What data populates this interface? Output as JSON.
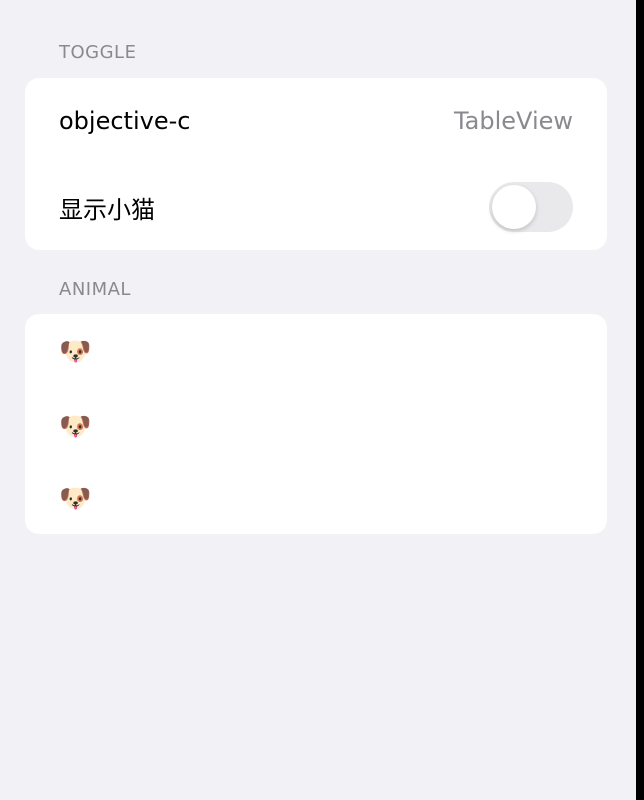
{
  "sections": {
    "toggle": {
      "header": "TOGGLE",
      "row1": {
        "title": "objective-c",
        "detail": "TableView"
      },
      "row2": {
        "title": "显示小猫",
        "toggle_on": false
      }
    },
    "animal": {
      "header": "ANIMAL",
      "items": [
        {
          "icon": "dog-face-icon",
          "glyph": "🐶"
        },
        {
          "icon": "dog-face-icon",
          "glyph": "🐶"
        },
        {
          "icon": "dog-face-icon",
          "glyph": "🐶"
        }
      ]
    }
  },
  "colors": {
    "background": "#f2f1f6",
    "card": "#ffffff",
    "secondary_text": "#8a8a8e",
    "toggle_off": "#e9e9eb"
  }
}
